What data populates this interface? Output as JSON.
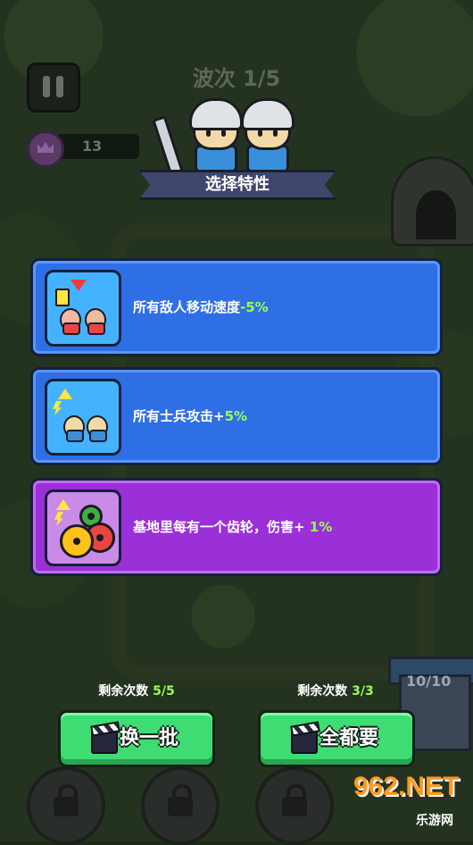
{
  "hud": {
    "wave_label": "波次 1/5",
    "gem_count": "13",
    "castle_hp": "10/10"
  },
  "title": "选择特性",
  "cards": [
    {
      "text": "所有敌人移动速度",
      "value": "-5%",
      "theme": "blue",
      "icon": "enemy-speed-down-icon"
    },
    {
      "text": "所有士兵攻击+",
      "value": "5%",
      "theme": "blue",
      "icon": "soldier-attack-up-icon"
    },
    {
      "text": "基地里每有一个齿轮，伤害+ ",
      "value": "1%",
      "theme": "purple",
      "icon": "gear-damage-icon"
    }
  ],
  "actions": {
    "reroll": {
      "counter_label": "剩余次数",
      "counter_value": "5/5",
      "button_label": "换一批"
    },
    "take_all": {
      "counter_label": "剩余次数",
      "counter_value": "3/3",
      "button_label": "全都要"
    }
  },
  "watermark": {
    "main": "962.NET",
    "sub": "乐游网"
  },
  "colors": {
    "card_blue": "#2f6fe6",
    "card_purple": "#9b2fd8",
    "button_green": "#3fdc73",
    "value_green": "#9aff55",
    "ribbon": "#40466b"
  }
}
